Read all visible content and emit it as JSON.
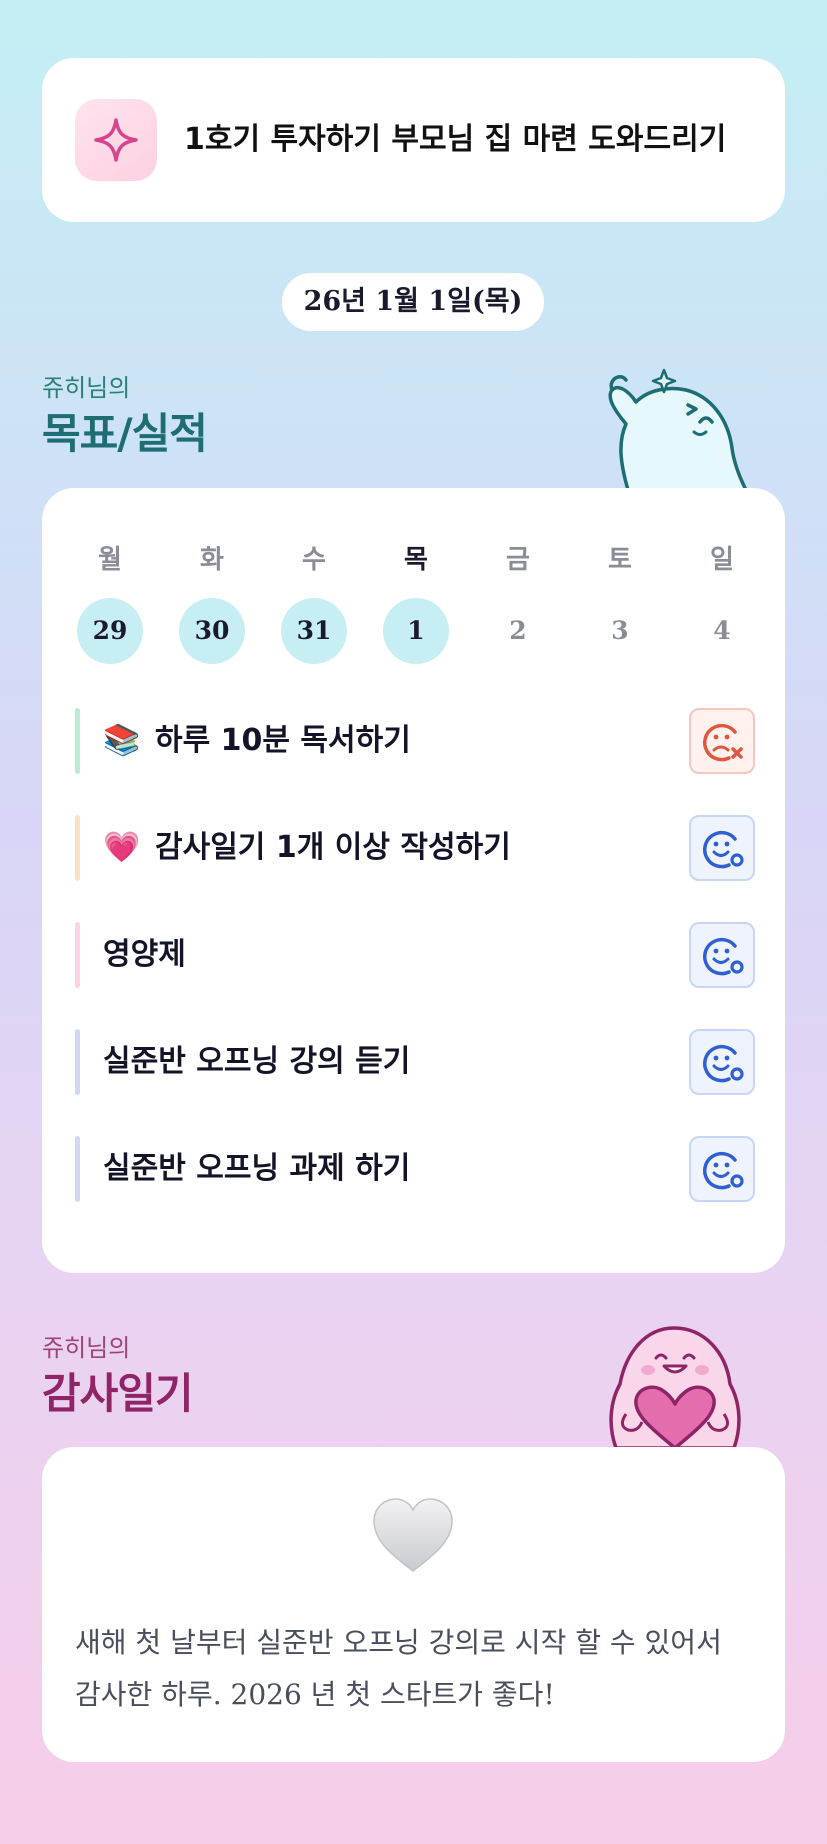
{
  "top_card": {
    "title": "1호기 투자하기 부모님 집 마련 도와드리기",
    "icon": "sparkle-icon"
  },
  "date_label": "26년 1월 1일(목)",
  "goals_section": {
    "subtitle": "쥬히님의",
    "title": "목표/실적"
  },
  "week": [
    {
      "day": "월",
      "date": "29",
      "checked": true
    },
    {
      "day": "화",
      "date": "30",
      "checked": true
    },
    {
      "day": "수",
      "date": "31",
      "checked": true
    },
    {
      "day": "목",
      "date": "1",
      "checked": true,
      "today": true
    },
    {
      "day": "금",
      "date": "2",
      "checked": false
    },
    {
      "day": "토",
      "date": "3",
      "checked": false
    },
    {
      "day": "일",
      "date": "4",
      "checked": false
    }
  ],
  "tasks": [
    {
      "emoji": "📚",
      "label": "하루 10분 독서하기",
      "bar_color": "#b9ecd2",
      "status": "fail",
      "status_icon": "sad-face-x-icon"
    },
    {
      "emoji": "💗",
      "label": "감사일기 1개 이상 작성하기",
      "bar_color": "#fde0c4",
      "status": "ok",
      "status_icon": "smile-face-check-icon"
    },
    {
      "emoji": "",
      "label": "영양제",
      "bar_color": "#fbd3e6",
      "status": "ok",
      "status_icon": "smile-face-check-icon"
    },
    {
      "emoji": "",
      "label": "실준반 오프닝 강의 듣기",
      "bar_color": "#cfd9f7",
      "status": "ok",
      "status_icon": "smile-face-check-icon"
    },
    {
      "emoji": "",
      "label": "실준반 오프닝 과제 하기",
      "bar_color": "#cfd9f7",
      "status": "ok",
      "status_icon": "smile-face-check-icon"
    }
  ],
  "thanks_section": {
    "subtitle": "쥬히님의",
    "title": "감사일기"
  },
  "thanks_entry": {
    "text": "새해 첫 날부터 실준반 오프닝 강의로 시작 할 수 있어서 감사한 하루. 2026 년 첫 스타트가 좋다!",
    "icon": "white-heart-icon"
  },
  "colors": {
    "accent_teal": "#1d6d73",
    "accent_pink": "#8f2566",
    "fail": "#e2553f",
    "ok": "#2f5fd0"
  }
}
